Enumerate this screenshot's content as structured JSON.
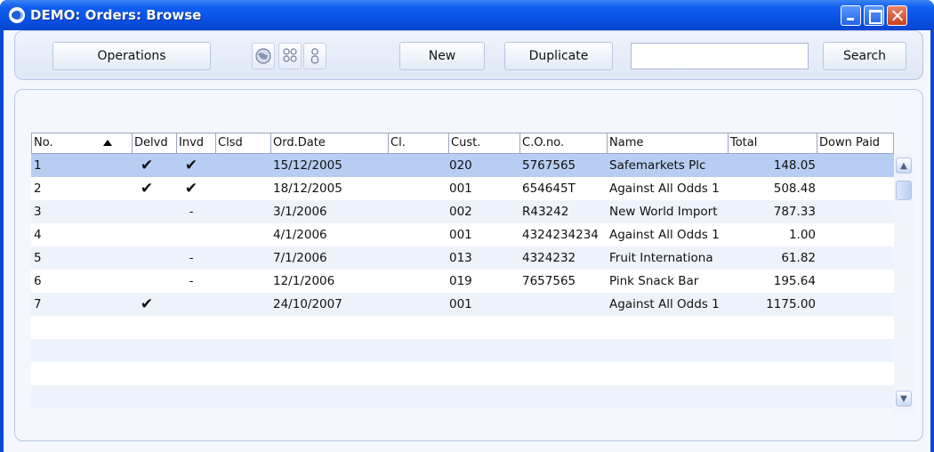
{
  "window": {
    "title": "DEMO: Orders: Browse"
  },
  "toolbar": {
    "operations_label": "Operations",
    "new_label": "New",
    "duplicate_label": "Duplicate",
    "search_value": "",
    "search_label": "Search"
  },
  "table": {
    "columns": [
      "No.",
      "Delvd",
      "Invd",
      "Clsd",
      "Ord.Date",
      "Cl.",
      "Cust.",
      "C.O.no.",
      "Name",
      "Total",
      "Down Paid"
    ],
    "rows": [
      {
        "no": "1",
        "delvd": "✔",
        "invd": "✔",
        "date": "15/12/2005",
        "cust": "020",
        "cono": "5767565",
        "name": "Safemarkets Plc",
        "total": "148.05"
      },
      {
        "no": "2",
        "delvd": "✔",
        "invd": "✔",
        "date": "18/12/2005",
        "cust": "001",
        "cono": "654645T",
        "name": "Against All Odds 1",
        "total": "508.48"
      },
      {
        "no": "3",
        "delvd": "",
        "invd": "-",
        "date": "3/1/2006",
        "cust": "002",
        "cono": "R43242",
        "name": "New World Import",
        "total": "787.33"
      },
      {
        "no": "4",
        "delvd": "",
        "invd": "",
        "date": "4/1/2006",
        "cust": "001",
        "cono": "4324234234",
        "name": "Against All Odds 1",
        "total": "1.00"
      },
      {
        "no": "5",
        "delvd": "",
        "invd": "-",
        "date": "7/1/2006",
        "cust": "013",
        "cono": "4324232",
        "name": "Fruit Internationa",
        "total": "61.82"
      },
      {
        "no": "6",
        "delvd": "",
        "invd": "-",
        "date": "12/1/2006",
        "cust": "019",
        "cono": "7657565",
        "name": "Pink Snack Bar",
        "total": "195.64"
      },
      {
        "no": "7",
        "delvd": "✔",
        "invd": "",
        "date": "24/10/2007",
        "cust": "001",
        "cono": "",
        "name": "Against All Odds 1",
        "total": "1175.00"
      }
    ]
  },
  "colors": {
    "titlebar": "#0a52e6",
    "selected_row": "#b7cdf2"
  },
  "icons": [
    "globe-icon",
    "people-icon",
    "person-icon",
    "scroll-up-icon",
    "scroll-down-icon"
  ]
}
